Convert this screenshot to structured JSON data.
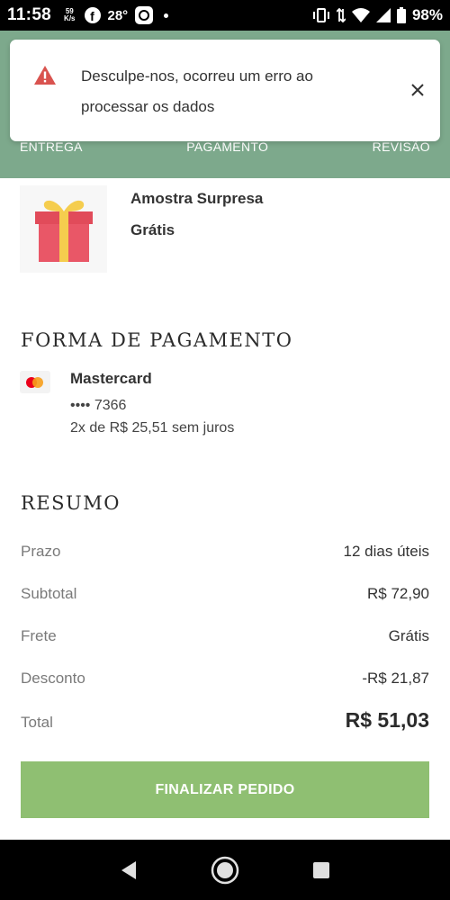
{
  "status_bar": {
    "time": "11:58",
    "speed_value": "59",
    "speed_unit": "K/s",
    "temperature": "28°",
    "battery": "98%"
  },
  "toast": {
    "message": "Desculpe-nos, ocorreu um erro ao processar os dados",
    "icon": "warning-icon",
    "accent": "#d9534f"
  },
  "steps": [
    {
      "label": "ENTREGA"
    },
    {
      "label": "PAGAMENTO"
    },
    {
      "label": "REVISÃO"
    }
  ],
  "product": {
    "name": "Amostra Surpresa",
    "price": "Grátis",
    "icon": "gift-icon"
  },
  "payment": {
    "title": "FORMA DE PAGAMENTO",
    "brand": "Mastercard",
    "number": "•••• 7366",
    "installments": "2x de R$ 25,51 sem juros"
  },
  "summary": {
    "title": "RESUMO",
    "rows": [
      {
        "label": "Prazo",
        "value": "12 dias úteis"
      },
      {
        "label": "Subtotal",
        "value": "R$ 72,90"
      },
      {
        "label": "Frete",
        "value": "Grátis"
      },
      {
        "label": "Desconto",
        "value": "-R$ 21,87"
      }
    ],
    "total_label": "Total",
    "total_value": "R$ 51,03"
  },
  "finalize_button": {
    "label": "FINALIZAR PEDIDO",
    "color": "#8fbf72"
  },
  "colors": {
    "header": "#7da98c",
    "text": "#2b2b2b"
  }
}
